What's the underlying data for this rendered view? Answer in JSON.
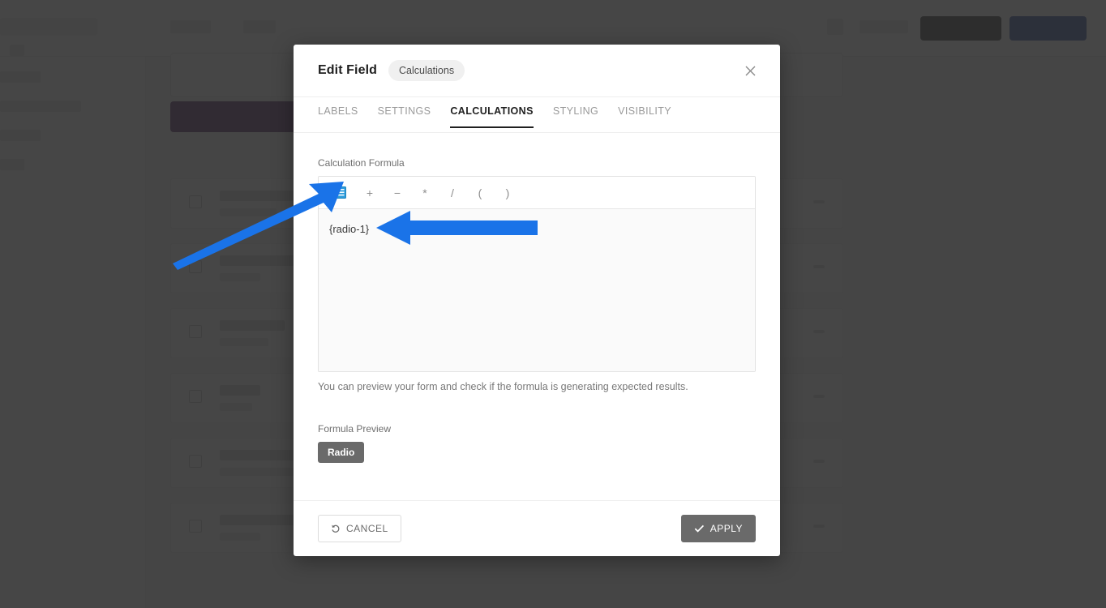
{
  "modal": {
    "title": "Edit Field",
    "badge": "Calculations",
    "close_icon": "close-icon",
    "tabs": [
      {
        "label": "LABELS",
        "active": false
      },
      {
        "label": "SETTINGS",
        "active": false
      },
      {
        "label": "CALCULATIONS",
        "active": true
      },
      {
        "label": "STYLING",
        "active": false
      },
      {
        "label": "VISIBILITY",
        "active": false
      }
    ],
    "calculations": {
      "formula_label": "Calculation Formula",
      "toolbar": {
        "insert_field_icon": "form-field-icon",
        "insert_field_color": "#2d9cdb",
        "operators": [
          "+",
          "−",
          "*",
          "/",
          "(",
          ")"
        ]
      },
      "formula_value": "{radio-1}",
      "helper_text": "You can preview your form and check if the formula is generating expected results.",
      "preview_label": "Formula Preview",
      "preview_value": "Radio"
    },
    "footer": {
      "cancel_label": "CANCEL",
      "cancel_icon": "undo-icon",
      "apply_label": "APPLY",
      "apply_icon": "check-icon",
      "apply_color": "#6a6a6a"
    }
  },
  "annotations": {
    "arrow_color": "#1a73e8",
    "arrows": [
      {
        "name": "arrow-to-insert-field-icon"
      },
      {
        "name": "arrow-to-formula-value"
      }
    ]
  },
  "background": {
    "scrim_color": "#282828",
    "accent_purple": "#6b3f7c"
  }
}
